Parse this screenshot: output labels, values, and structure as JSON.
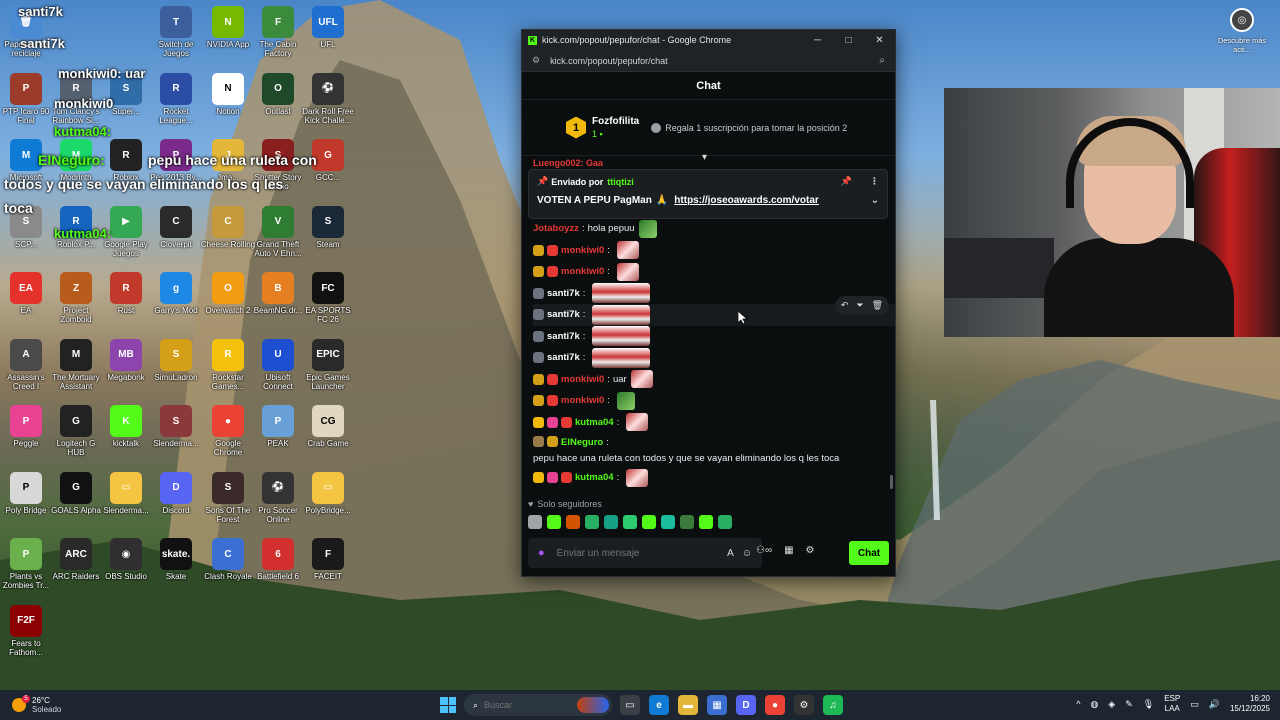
{
  "overlay": {
    "lines": [
      {
        "text": "santi7k",
        "color": "#ffffff"
      },
      {
        "text": "santi7k",
        "color": "#ffffff"
      },
      {
        "text": "monkiwi0: uar",
        "color": "#ffffff"
      },
      {
        "text": "monkiwi0",
        "color": "#ffffff"
      },
      {
        "text": "kutma04:",
        "color": "#53fc18"
      },
      {
        "text": "ElNeguro:",
        "color": "#53fc18"
      },
      {
        "text": "pepu hace una ruleta con",
        "color": "#ffffff"
      },
      {
        "text": "todos y que se vayan eliminando los q les",
        "color": "#ffffff"
      },
      {
        "text": "toca",
        "color": "#ffffff"
      },
      {
        "text": "kutma04:",
        "color": "#53fc18"
      }
    ]
  },
  "desktop": {
    "icons": [
      {
        "label": "Papelera de reciclaje",
        "color": "#4b8bd4",
        "glyph": "🗑"
      },
      {
        "label": "Switch de Juegos",
        "color": "#3b5f9c",
        "glyph": "T"
      },
      {
        "label": "NVIDIA App",
        "color": "#76b900",
        "glyph": "N"
      },
      {
        "label": "The Cabin Factory",
        "color": "#3c8a3c",
        "glyph": "F"
      },
      {
        "label": "UFL",
        "color": "#1f6fd1",
        "glyph": "UFL"
      },
      {
        "label": "PTP Icaro 90 Final",
        "color": "#9b3b2a",
        "glyph": "P"
      },
      {
        "label": "Tom Clancy's Rainbow Si...",
        "color": "#556070",
        "glyph": "R"
      },
      {
        "label": "Super...",
        "color": "#2f6ca8",
        "glyph": "S"
      },
      {
        "label": "Rocket League...",
        "color": "#2b4da3",
        "glyph": "R"
      },
      {
        "label": "Notion",
        "color": "#ffffff",
        "glyph": "N"
      },
      {
        "label": "Outlast",
        "color": "#1e4a2a",
        "glyph": "O"
      },
      {
        "label": "Dark Roll Free Kick Challe...",
        "color": "#333333",
        "glyph": "⚽"
      },
      {
        "label": "Microsoft",
        "color": "#0f7bd4",
        "glyph": "M"
      },
      {
        "label": "Modrinth",
        "color": "#1bd96a",
        "glyph": "M"
      },
      {
        "label": "Roblox",
        "color": "#222222",
        "glyph": "R"
      },
      {
        "label": "Pes 2013 By...",
        "color": "#7a2a8a",
        "glyph": "P"
      },
      {
        "label": "Jma...",
        "color": "#e2b73a",
        "glyph": "J"
      },
      {
        "label": "Shutter Story Demo",
        "color": "#8a1f1f",
        "glyph": "S"
      },
      {
        "label": "GCC...",
        "color": "#c0392b",
        "glyph": "G"
      },
      {
        "label": "SCP...",
        "color": "#8a8a8a",
        "glyph": "S"
      },
      {
        "label": "Roblox P...",
        "color": "#1565c0",
        "glyph": "R"
      },
      {
        "label": "Google Play Juegos",
        "color": "#34a853",
        "glyph": "▶"
      },
      {
        "label": "Cloverpit",
        "color": "#2a2a2a",
        "glyph": "C"
      },
      {
        "label": "Cheese Rolling",
        "color": "#c49a3a",
        "glyph": "C"
      },
      {
        "label": "Grand Theft Auto V Ehn...",
        "color": "#2e7d32",
        "glyph": "V"
      },
      {
        "label": "Steam",
        "color": "#1b2838",
        "glyph": "S"
      },
      {
        "label": "EA",
        "color": "#e4312b",
        "glyph": "EA"
      },
      {
        "label": "Project Zomboid",
        "color": "#b85c1e",
        "glyph": "Z"
      },
      {
        "label": "Rust",
        "color": "#c0392b",
        "glyph": "R"
      },
      {
        "label": "Garry's Mod",
        "color": "#1e88e5",
        "glyph": "g"
      },
      {
        "label": "Overwatch 2",
        "color": "#f39c12",
        "glyph": "O"
      },
      {
        "label": "BeamNG.dr...",
        "color": "#e67e22",
        "glyph": "B"
      },
      {
        "label": "EA SPORTS FC 26",
        "color": "#111111",
        "glyph": "FC"
      },
      {
        "label": "Assassin's Creed I",
        "color": "#4a4a4a",
        "glyph": "A"
      },
      {
        "label": "The Mortuary Assistant",
        "color": "#222222",
        "glyph": "M"
      },
      {
        "label": "Megabonk",
        "color": "#8e44ad",
        "glyph": "MB"
      },
      {
        "label": "SimuLadron",
        "color": "#d4a017",
        "glyph": "S"
      },
      {
        "label": "Rockstar Games...",
        "color": "#f4c20d",
        "glyph": "R"
      },
      {
        "label": "Ubisoft Connect",
        "color": "#1f4fd1",
        "glyph": "U"
      },
      {
        "label": "Epic Games Launcher",
        "color": "#2a2a2a",
        "glyph": "EPIC"
      },
      {
        "label": "Peggle",
        "color": "#e84393",
        "glyph": "P"
      },
      {
        "label": "Logitech G HUB",
        "color": "#222222",
        "glyph": "G"
      },
      {
        "label": "kicktalk",
        "color": "#53fc18",
        "glyph": "K"
      },
      {
        "label": "Slenderma...",
        "color": "#8a3a3a",
        "glyph": "S"
      },
      {
        "label": "Google Chrome",
        "color": "#ea4335",
        "glyph": "●"
      },
      {
        "label": "PEAK",
        "color": "#6aa0d8",
        "glyph": "P"
      },
      {
        "label": "Crab Game",
        "color": "#e0d8c0",
        "glyph": "CG"
      },
      {
        "label": "Poly Bridge",
        "color": "#d8d8d8",
        "glyph": "P"
      },
      {
        "label": "GOALS Alpha",
        "color": "#111111",
        "glyph": "G"
      },
      {
        "label": "Slenderma...",
        "color": "#f4c542",
        "glyph": "▭"
      },
      {
        "label": "Discord",
        "color": "#5865f2",
        "glyph": "D"
      },
      {
        "label": "Sons Of The Forest",
        "color": "#3a2a2a",
        "glyph": "S"
      },
      {
        "label": "Pro Soccer Online",
        "color": "#333333",
        "glyph": "⚽"
      },
      {
        "label": "PolyBridge...",
        "color": "#f4c542",
        "glyph": "▭"
      },
      {
        "label": "Plants vs Zombies Tr...",
        "color": "#6ab04c",
        "glyph": "P"
      },
      {
        "label": "ARC Raiders",
        "color": "#2a2a2a",
        "glyph": "ARC"
      },
      {
        "label": "OBS Studio",
        "color": "#302e31",
        "glyph": "◉"
      },
      {
        "label": "Skate",
        "color": "#111111",
        "glyph": "skate."
      },
      {
        "label": "Clash Royale",
        "color": "#3b6fd1",
        "glyph": "C"
      },
      {
        "label": "Battlefield 6",
        "color": "#d32f2f",
        "glyph": "6"
      },
      {
        "label": "FACEIT",
        "color": "#1a1a1a",
        "glyph": "F"
      },
      {
        "label": "Fears to Fathom...",
        "color": "#8b0000",
        "glyph": "F2F"
      }
    ]
  },
  "widget": {
    "label": "Descubre más acti..."
  },
  "chrome": {
    "title": "kick.com/popout/pepufor/chat - Google Chrome",
    "url": "kick.com/popout/pepufor/chat",
    "minimize": "─",
    "maximize": "□",
    "close": "✕"
  },
  "chat": {
    "header": "Chat",
    "leader": {
      "rank": "1",
      "name": "Fozfofilita",
      "count": "1",
      "gift_text": "Regala 1 suscripción para tomar la posición 2"
    },
    "pinned": {
      "sent_by_label": "Enviado por",
      "sent_by_user": "ttiqtizi",
      "message": "VOTEN A PEPU PagMan",
      "link": "https://joseoawards.com/votar"
    },
    "partial_top": "Luengo002: Gaa",
    "messages": [
      {
        "user": "Jotaboyzz",
        "color": "#e53935",
        "text": "hola pepuu",
        "emote": "frog",
        "badges": []
      },
      {
        "user": "monkiwi0",
        "color": "#e53935",
        "text": "",
        "emote": "small",
        "badges": [
          "#d4a017",
          "#e53935"
        ]
      },
      {
        "user": "monkiwi0",
        "color": "#e53935",
        "text": "",
        "emote": "small",
        "badges": [
          "#d4a017",
          "#e53935"
        ]
      },
      {
        "user": "santi7k",
        "color": "#ffffff",
        "text": "",
        "emote": "big",
        "badges": [
          "#6b7280"
        ]
      },
      {
        "user": "santi7k",
        "color": "#ffffff",
        "text": "",
        "emote": "big",
        "badges": [
          "#6b7280"
        ],
        "hover": true
      },
      {
        "user": "santi7k",
        "color": "#ffffff",
        "text": "",
        "emote": "big",
        "badges": [
          "#6b7280"
        ]
      },
      {
        "user": "santi7k",
        "color": "#ffffff",
        "text": "",
        "emote": "big",
        "badges": [
          "#6b7280"
        ]
      },
      {
        "user": "monkiwi0",
        "color": "#e53935",
        "text": "uar",
        "emote": "small",
        "badges": [
          "#d4a017",
          "#e53935"
        ]
      },
      {
        "user": "monkiwi0",
        "color": "#e53935",
        "text": "",
        "emote": "frog",
        "badges": [
          "#d4a017",
          "#e53935"
        ]
      },
      {
        "user": "kutma04",
        "color": "#53fc18",
        "text": "",
        "emote": "small",
        "badges": [
          "#f0b90b",
          "#e84393",
          "#e53935"
        ]
      },
      {
        "user": "ElNeguro",
        "color": "#53fc18",
        "text": "pepu hace una ruleta con todos y que se vayan eliminando los q les toca",
        "emote": "",
        "badges": [
          "#9a7a4a",
          "#d4a017"
        ],
        "multi": true
      },
      {
        "user": "kutma04",
        "color": "#53fc18",
        "text": "",
        "emote": "small",
        "badges": [
          "#f0b90b",
          "#e84393",
          "#e53935"
        ]
      }
    ],
    "followers_only": "Solo seguidores",
    "composer_placeholder": "Enviar un mensaje",
    "send_label": "Chat"
  },
  "taskbar": {
    "temp": "26°C",
    "weather": "Soleado",
    "weather_badge": "5",
    "search_placeholder": "Buscar",
    "lang1": "ESP",
    "lang2": "LAA",
    "time": "16:20",
    "date": "15/12/2025"
  }
}
